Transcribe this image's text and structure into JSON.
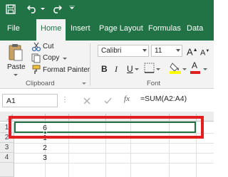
{
  "app": {
    "accent": "#217346",
    "highlight_color": "#e02020"
  },
  "tabs": {
    "file": "File",
    "home": "Home",
    "insert": "Insert",
    "page_layout": "Page Layout",
    "formulas": "Formulas",
    "data": "Data"
  },
  "clipboard": {
    "paste": "Paste",
    "cut": "Cut",
    "copy": "Copy",
    "format_painter": "Format Painter",
    "group_label": "Clipboard"
  },
  "font": {
    "font_name": "Calibri",
    "font_size": "11",
    "bold": "B",
    "italic": "I",
    "underline": "U",
    "font_color_glyph": "A",
    "font_color": "#e02020",
    "fill_color": "#ffff00",
    "group_label": "Font"
  },
  "formula_bar": {
    "name_box": "A1",
    "formula": "=SUM(A2:A4)"
  },
  "sheet": {
    "rows": [
      {
        "label": "1",
        "value": "6"
      },
      {
        "label": "2",
        "value": "1"
      },
      {
        "label": "3",
        "value": "2"
      },
      {
        "label": "4",
        "value": "3"
      }
    ]
  }
}
